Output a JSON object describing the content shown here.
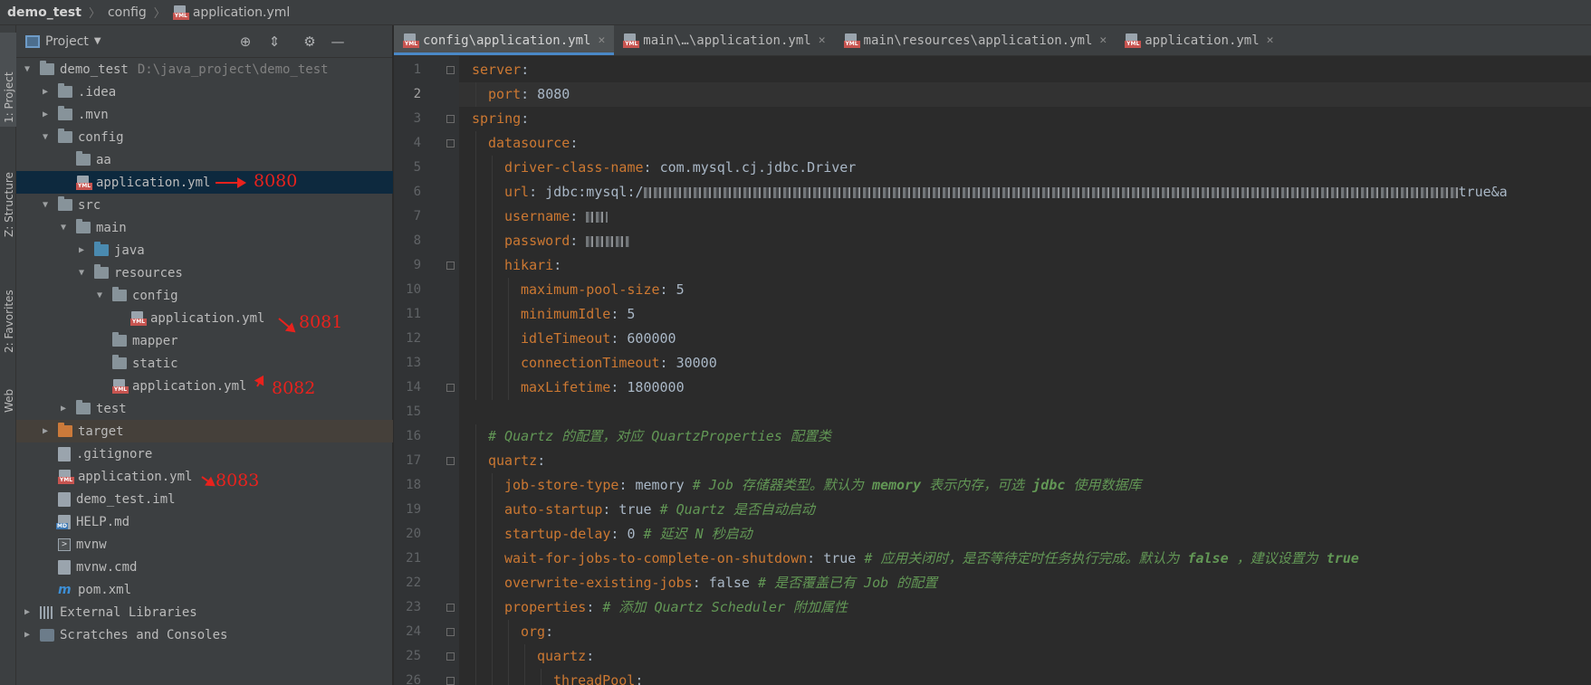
{
  "breadcrumbs": [
    {
      "label": "demo_test",
      "icon": "folder-icon"
    },
    {
      "label": "config",
      "icon": "folder-icon"
    },
    {
      "label": "application.yml",
      "icon": "yml-file-icon"
    }
  ],
  "project_panel": {
    "title": "Project",
    "tree": [
      {
        "label": "demo_test",
        "path": "D:\\java_project\\demo_test",
        "depth": 0,
        "icon": "module-folder",
        "expanded": true
      },
      {
        "label": ".idea",
        "depth": 1,
        "icon": "folder",
        "expanded": false
      },
      {
        "label": ".mvn",
        "depth": 1,
        "icon": "folder",
        "expanded": false
      },
      {
        "label": "config",
        "depth": 1,
        "icon": "folder",
        "expanded": true
      },
      {
        "label": "aa",
        "depth": 2,
        "icon": "folder",
        "leaf": true
      },
      {
        "label": "application.yml",
        "depth": 2,
        "icon": "yml",
        "leaf": true,
        "selected": true
      },
      {
        "label": "src",
        "depth": 1,
        "icon": "folder",
        "expanded": true
      },
      {
        "label": "main",
        "depth": 2,
        "icon": "folder",
        "expanded": true
      },
      {
        "label": "java",
        "depth": 3,
        "icon": "folder-blue",
        "expanded": false
      },
      {
        "label": "resources",
        "depth": 3,
        "icon": "folder-res",
        "expanded": true
      },
      {
        "label": "config",
        "depth": 4,
        "icon": "folder",
        "expanded": true
      },
      {
        "label": "application.yml",
        "depth": 5,
        "icon": "yml",
        "leaf": true
      },
      {
        "label": "mapper",
        "depth": 4,
        "icon": "folder",
        "leaf": true
      },
      {
        "label": "static",
        "depth": 4,
        "icon": "folder",
        "leaf": true
      },
      {
        "label": "application.yml",
        "depth": 4,
        "icon": "yml",
        "leaf": true
      },
      {
        "label": "test",
        "depth": 2,
        "icon": "folder",
        "expanded": false
      },
      {
        "label": "target",
        "depth": 1,
        "icon": "folder-orange",
        "expanded": false,
        "highlight": true
      },
      {
        "label": ".gitignore",
        "depth": 1,
        "icon": "file",
        "leaf": true
      },
      {
        "label": "application.yml",
        "depth": 1,
        "icon": "yml",
        "leaf": true
      },
      {
        "label": "demo_test.iml",
        "depth": 1,
        "icon": "file",
        "leaf": true
      },
      {
        "label": "HELP.md",
        "depth": 1,
        "icon": "md",
        "leaf": true
      },
      {
        "label": "mvnw",
        "depth": 1,
        "icon": "term",
        "leaf": true
      },
      {
        "label": "mvnw.cmd",
        "depth": 1,
        "icon": "file",
        "leaf": true
      },
      {
        "label": "pom.xml",
        "depth": 1,
        "icon": "maven",
        "leaf": true
      },
      {
        "label": "External Libraries",
        "depth": 0,
        "icon": "libs",
        "expanded": false
      },
      {
        "label": "Scratches and Consoles",
        "depth": 0,
        "icon": "scratch",
        "expanded": false
      }
    ]
  },
  "annotations": [
    {
      "label": "8080",
      "row": 5
    },
    {
      "label": "8081",
      "row": 11
    },
    {
      "label": "8082",
      "row": 14
    },
    {
      "label": "8083",
      "row": 18
    }
  ],
  "tool_strip": [
    {
      "label": "1: Project",
      "active": true
    },
    {
      "label": "Z: Structure"
    },
    {
      "label": "2: Favorites"
    },
    {
      "label": "Web"
    }
  ],
  "tabs": [
    {
      "label": "config\\application.yml",
      "active": true
    },
    {
      "label": "main\\…\\application.yml"
    },
    {
      "label": "main\\resources\\application.yml"
    },
    {
      "label": "application.yml"
    }
  ],
  "editor": {
    "current_line": 2,
    "lines": [
      {
        "n": 1,
        "fold": true,
        "indent": 0,
        "parts": [
          [
            "k",
            "server"
          ],
          [
            "v",
            ":"
          ]
        ]
      },
      {
        "n": 2,
        "indent": 1,
        "parts": [
          [
            "k",
            "port"
          ],
          [
            "v",
            ": 8080"
          ]
        ]
      },
      {
        "n": 3,
        "fold": true,
        "indent": 0,
        "parts": [
          [
            "k",
            "spring"
          ],
          [
            "v",
            ":"
          ]
        ]
      },
      {
        "n": 4,
        "fold": true,
        "indent": 1,
        "parts": [
          [
            "k",
            "datasource"
          ],
          [
            "v",
            ":"
          ]
        ]
      },
      {
        "n": 5,
        "indent": 2,
        "parts": [
          [
            "k",
            "driver-class-name"
          ],
          [
            "v",
            ": com.mysql.cj.jdbc.Driver"
          ]
        ]
      },
      {
        "n": 6,
        "indent": 2,
        "parts": [
          [
            "k",
            "url"
          ],
          [
            "v",
            ": jdbc:mysql:/"
          ],
          [
            "blur",
            "900"
          ],
          [
            "v",
            "true&a"
          ]
        ]
      },
      {
        "n": 7,
        "indent": 2,
        "parts": [
          [
            "k",
            "username"
          ],
          [
            "v",
            ": "
          ],
          [
            "blur",
            "24"
          ]
        ]
      },
      {
        "n": 8,
        "indent": 2,
        "parts": [
          [
            "k",
            "password"
          ],
          [
            "v",
            ": "
          ],
          [
            "blur",
            "48"
          ]
        ]
      },
      {
        "n": 9,
        "fold": true,
        "indent": 2,
        "parts": [
          [
            "k",
            "hikari"
          ],
          [
            "v",
            ":"
          ]
        ]
      },
      {
        "n": 10,
        "indent": 3,
        "parts": [
          [
            "k",
            "maximum-pool-size"
          ],
          [
            "v",
            ": 5"
          ]
        ]
      },
      {
        "n": 11,
        "indent": 3,
        "parts": [
          [
            "k",
            "minimumIdle"
          ],
          [
            "v",
            ": 5"
          ]
        ]
      },
      {
        "n": 12,
        "indent": 3,
        "parts": [
          [
            "k",
            "idleTimeout"
          ],
          [
            "v",
            ": 600000"
          ]
        ]
      },
      {
        "n": 13,
        "indent": 3,
        "parts": [
          [
            "k",
            "connectionTimeout"
          ],
          [
            "v",
            ": 30000"
          ]
        ]
      },
      {
        "n": 14,
        "fold": true,
        "indent": 3,
        "parts": [
          [
            "k",
            "maxLifetime"
          ],
          [
            "v",
            ": 1800000"
          ]
        ]
      },
      {
        "n": 15,
        "indent": 0,
        "parts": []
      },
      {
        "n": 16,
        "indent": 1,
        "parts": [
          [
            "c",
            "# Quartz 的配置，对应 QuartzProperties 配置类"
          ]
        ]
      },
      {
        "n": 17,
        "fold": true,
        "indent": 1,
        "parts": [
          [
            "k",
            "quartz"
          ],
          [
            "v",
            ":"
          ]
        ]
      },
      {
        "n": 18,
        "indent": 2,
        "parts": [
          [
            "k",
            "job-store-type"
          ],
          [
            "v",
            ": memory "
          ],
          [
            "c",
            "# Job 存储器类型。默认为 "
          ],
          [
            "cb",
            "memory"
          ],
          [
            "c",
            " 表示内存，可选 "
          ],
          [
            "cb",
            "jdbc"
          ],
          [
            "c",
            " 使用数据库"
          ]
        ]
      },
      {
        "n": 19,
        "indent": 2,
        "parts": [
          [
            "k",
            "auto-startup"
          ],
          [
            "v",
            ": true "
          ],
          [
            "c",
            "# Quartz 是否自动启动"
          ]
        ]
      },
      {
        "n": 20,
        "indent": 2,
        "parts": [
          [
            "k",
            "startup-delay"
          ],
          [
            "v",
            ": 0 "
          ],
          [
            "c",
            "# 延迟 N 秒启动"
          ]
        ]
      },
      {
        "n": 21,
        "indent": 2,
        "parts": [
          [
            "k",
            "wait-for-jobs-to-complete-on-shutdown"
          ],
          [
            "v",
            ": true "
          ],
          [
            "c",
            "# 应用关闭时，是否等待定时任务执行完成。默认为 "
          ],
          [
            "cb",
            "false"
          ],
          [
            "c",
            " ，建议设置为 "
          ],
          [
            "cb",
            "true"
          ]
        ]
      },
      {
        "n": 22,
        "indent": 2,
        "parts": [
          [
            "k",
            "overwrite-existing-jobs"
          ],
          [
            "v",
            ": false "
          ],
          [
            "c",
            "# 是否覆盖已有 Job 的配置"
          ]
        ]
      },
      {
        "n": 23,
        "fold": true,
        "indent": 2,
        "parts": [
          [
            "k",
            "properties"
          ],
          [
            "v",
            ": "
          ],
          [
            "c",
            "# 添加 Quartz Scheduler 附加属性"
          ]
        ]
      },
      {
        "n": 24,
        "fold": true,
        "indent": 3,
        "parts": [
          [
            "k",
            "org"
          ],
          [
            "v",
            ":"
          ]
        ]
      },
      {
        "n": 25,
        "fold": true,
        "indent": 4,
        "parts": [
          [
            "k",
            "quartz"
          ],
          [
            "v",
            ":"
          ]
        ]
      },
      {
        "n": 26,
        "fold": true,
        "indent": 5,
        "parts": [
          [
            "k",
            "threadPool"
          ],
          [
            "v",
            ":"
          ]
        ]
      }
    ]
  },
  "colors": {
    "keyword": "#cc7832",
    "comment": "#629755",
    "text": "#a9b7c6",
    "annotation": "#e8221d",
    "selection": "#0d293e"
  }
}
